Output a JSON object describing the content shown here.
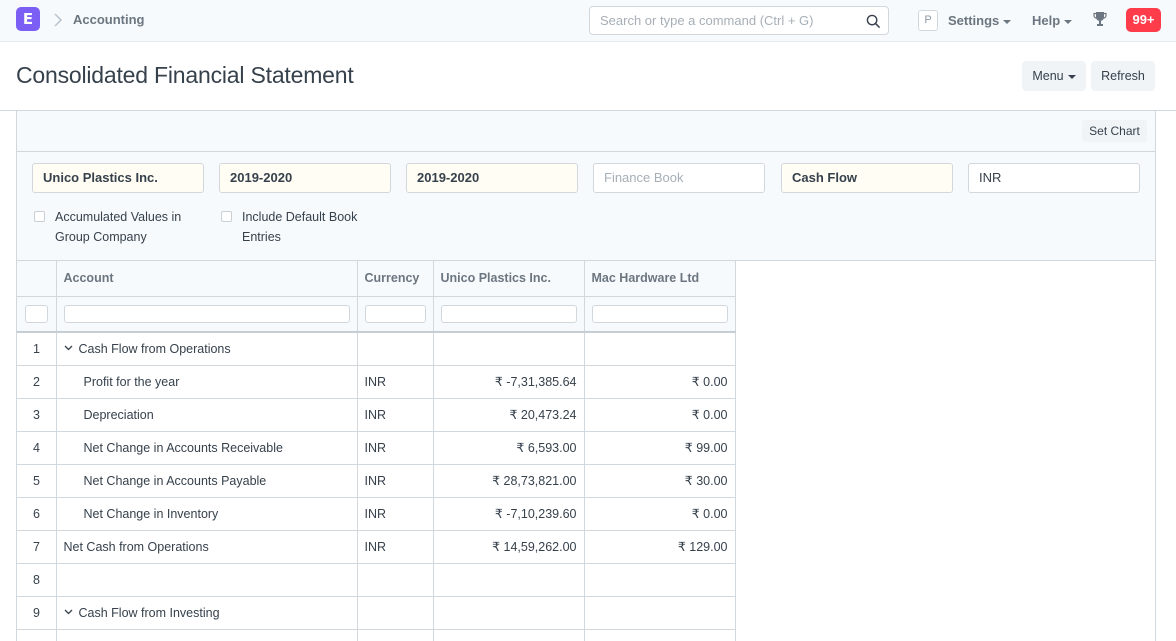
{
  "navbar": {
    "logo": "E",
    "breadcrumb": "Accounting",
    "search_placeholder": "Search or type a command (Ctrl + G)",
    "p_badge": "P",
    "settings_label": "Settings",
    "help_label": "Help",
    "notifications_count": "99+"
  },
  "page": {
    "title": "Consolidated Financial Statement",
    "menu_label": "Menu",
    "refresh_label": "Refresh",
    "set_chart_label": "Set Chart"
  },
  "filters": {
    "company": "Unico Plastics Inc.",
    "from_fiscal_year": "2019-2020",
    "to_fiscal_year": "2019-2020",
    "finance_book_placeholder": "Finance Book",
    "report": "Cash Flow",
    "currency": "INR",
    "accumulated_label": "Accumulated Values in Group Company",
    "include_default_label": "Include Default Book Entries"
  },
  "table": {
    "columns": [
      "Account",
      "Currency",
      "Unico Plastics Inc.",
      "Mac Hardware Ltd"
    ],
    "rows": [
      {
        "n": "1",
        "account": "Cash Flow from Operations",
        "currency": "",
        "unico": "",
        "mac": ""
      },
      {
        "n": "2",
        "account": "Profit for the year",
        "currency": "INR",
        "unico": "₹ -7,31,385.64",
        "mac": "₹ 0.00"
      },
      {
        "n": "3",
        "account": "Depreciation",
        "currency": "INR",
        "unico": "₹ 20,473.24",
        "mac": "₹ 0.00"
      },
      {
        "n": "4",
        "account": "Net Change in Accounts Receivable",
        "currency": "INR",
        "unico": "₹ 6,593.00",
        "mac": "₹ 99.00"
      },
      {
        "n": "5",
        "account": "Net Change in Accounts Payable",
        "currency": "INR",
        "unico": "₹ 28,73,821.00",
        "mac": "₹ 30.00"
      },
      {
        "n": "6",
        "account": "Net Change in Inventory",
        "currency": "INR",
        "unico": "₹ -7,10,239.60",
        "mac": "₹ 0.00"
      },
      {
        "n": "7",
        "account": "Net Cash from Operations",
        "currency": "INR",
        "unico": "₹ 14,59,262.00",
        "mac": "₹ 129.00"
      },
      {
        "n": "8",
        "account": "",
        "currency": "",
        "unico": "",
        "mac": ""
      },
      {
        "n": "9",
        "account": "Cash Flow from Investing",
        "currency": "",
        "unico": "",
        "mac": ""
      },
      {
        "n": "",
        "account": "",
        "currency": "",
        "unico": "",
        "mac": ""
      }
    ]
  },
  "colors": {
    "brand": "#7b5ff5",
    "notification": "#ff3c4a"
  }
}
